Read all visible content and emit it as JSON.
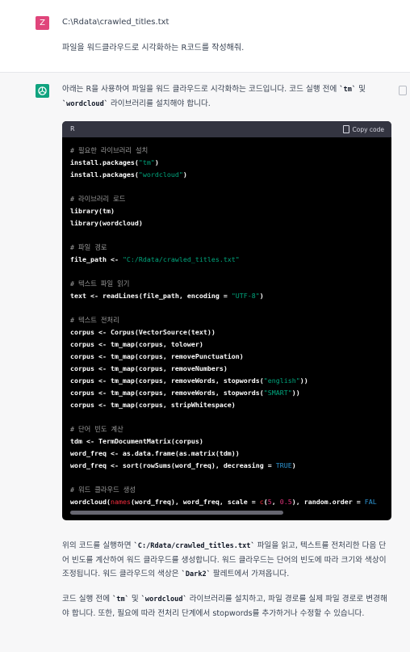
{
  "user_message": {
    "avatar_letter": "Z",
    "line1": "C:\\Rdata\\crawled_titles.txt",
    "line2": "파일을 워드클라우드로 시각화하는 R코드를 작성해줘."
  },
  "assistant_message": {
    "intro": {
      "part1": "아래는 R을 사용하여 파일을 워드 클라우드로 시각화하는 코드입니다. 코드 실행 전에 ",
      "code1": "`tm`",
      "part2": " 및",
      "code2": "`wordcloud`",
      "part3": " 라이브러리를 설치해야 합니다."
    },
    "code_block": {
      "language": "R",
      "copy_label": "Copy code",
      "lines": {
        "c1": "# 필요한 라이브러리 설치",
        "l1": "install.packages(",
        "s1": "\"tm\"",
        "e1": ")",
        "l2": "install.packages(",
        "s2": "\"wordcloud\"",
        "e2": ")",
        "c2": "# 라이브러리 로드",
        "l3": "library(tm)",
        "l4": "library(wordcloud)",
        "c3": "# 파일 경로",
        "l5": "file_path <- ",
        "s5": "\"C:/Rdata/crawled_titles.txt\"",
        "c4": "# 텍스트 파일 읽기",
        "l6": "text <- readLines(file_path, encoding = ",
        "s6": "\"UTF-8\"",
        "e6": ")",
        "c5": "# 텍스트 전처리",
        "l7": "corpus <- Corpus(VectorSource(text))",
        "l8": "corpus <- tm_map(corpus, tolower)",
        "l9": "corpus <- tm_map(corpus, removePunctuation)",
        "l10": "corpus <- tm_map(corpus, removeNumbers)",
        "l11": "corpus <- tm_map(corpus, removeWords, stopwords(",
        "s11": "\"english\"",
        "e11": "))",
        "l12": "corpus <- tm_map(corpus, removeWords, stopwords(",
        "s12": "\"SMART\"",
        "e12": "))",
        "l13": "corpus <- tm_map(corpus, stripWhitespace)",
        "c6": "# 단어 빈도 계산",
        "l14": "tdm <- TermDocumentMatrix(corpus)",
        "l15": "word_freq <- as.data.frame(as.matrix(tdm))",
        "l16": "word_freq <- sort(rowSums(word_freq), decreasing = ",
        "k16": "TRUE",
        "e16": ")",
        "c7": "# 워드 클라우드 생성",
        "l17": "wordcloud(",
        "f17": "names",
        "m17": "(word_freq), word_freq, scale = ",
        "f17b": "c",
        "p17a": "(",
        "n17a": "5",
        "p17b": ", ",
        "n17b": "0.5",
        "t17": "), random.order = ",
        "k17": "FAL"
      }
    },
    "para2": {
      "part1": "위의 코드를 실행하면 ",
      "code1": "`C:/Rdata/crawled_titles.txt`",
      "part2": " 파일을 읽고, 텍스트를 전처리한 다음 단어 빈도를 계산하여 워드 클라우드를 생성합니다. 워드 클라우드는 단어의 빈도에 따라 크기와 색상이 조정됩니다. 워드 클라우드의 색상은 ",
      "code2": "`Dark2`",
      "part3": " 팔레트에서 가져옵니다."
    },
    "para3": {
      "part1": "코드 실행 전에 ",
      "code1": "`tm`",
      "part2": " 및 ",
      "code2": "`wordcloud`",
      "part3": " 라이브러리를 설치하고, 파일 경로를 실제 파일 경로로 변경해야 합니다. 또한, 필요에 따라 전처리 단계에서 stopwords를 추가하거나 수정할 수 있습니다."
    }
  },
  "colors": {
    "user_avatar": "#e0457b",
    "assistant_avatar": "#10a37f",
    "code_bg": "#000000",
    "code_header_bg": "#343541",
    "string": "#00a67d",
    "number": "#df3079",
    "keyword": "#2e95d3"
  },
  "icons": {
    "assistant_avatar": "openai-logo-icon",
    "copy": "clipboard-icon"
  }
}
